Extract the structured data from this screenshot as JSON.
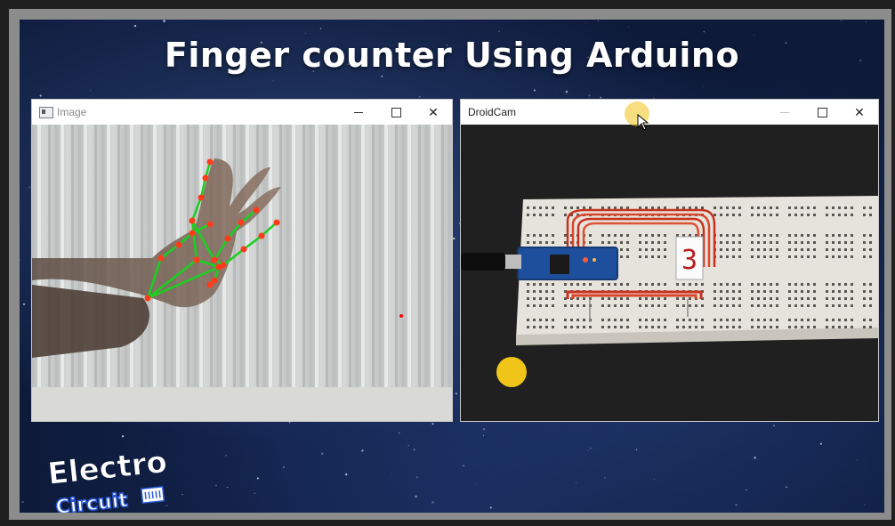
{
  "video": {
    "headline": "Finger counter Using Arduino"
  },
  "windows": {
    "image": {
      "title": "Image",
      "icon": "app-window-icon",
      "controls": {
        "minimize": "—",
        "maximize": "☐",
        "close": "✕"
      }
    },
    "droidcam": {
      "title": "DroidCam",
      "controls": {
        "minimize": "—",
        "maximize": "☐",
        "close": "✕"
      }
    }
  },
  "display": {
    "seven_segment_digit": "3"
  },
  "logo": {
    "line1": "Electro",
    "line2": "Circuit"
  },
  "colors": {
    "landmark_line": "#19d11f",
    "landmark_point": "#ff3b1a",
    "cursor_highlight": "#f0c419",
    "tracking_dot": "#ff0000"
  }
}
